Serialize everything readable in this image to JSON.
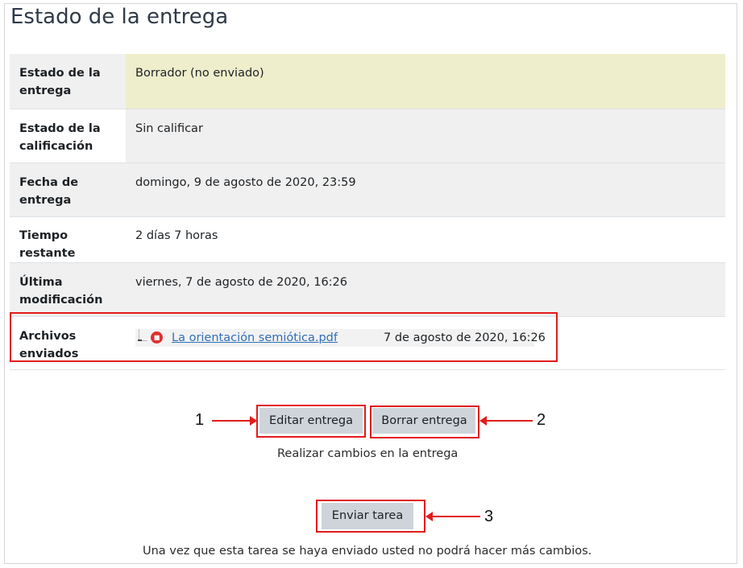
{
  "page": {
    "title": "Estado de la entrega"
  },
  "rows": [
    {
      "label": "Estado de la entrega",
      "value": "Borrador (no enviado)"
    },
    {
      "label": "Estado de la calificación",
      "value": "Sin calificar"
    },
    {
      "label": "Fecha de entrega",
      "value": "domingo, 9 de agosto de 2020, 23:59"
    },
    {
      "label": "Tiempo restante",
      "value": "2 días 7 horas"
    },
    {
      "label": "Última modificación",
      "value": "viernes, 7 de agosto de 2020, 16:26"
    },
    {
      "label": "Archivos enviados",
      "file_name": "La orientación semiótica.pdf",
      "file_date": "7 de agosto de 2020, 16:26",
      "file_icon": "pdf-icon"
    }
  ],
  "actions": {
    "edit_label": "Editar entrega",
    "delete_label": "Borrar entrega",
    "edit_help": "Realizar cambios en la entrega",
    "submit_label": "Enviar tarea",
    "submit_help": "Una vez que esta tarea se haya enviado usted no podrá hacer más cambios."
  },
  "annotations": {
    "one": "1",
    "two": "2",
    "three": "3",
    "highlight_color": "#e21b1b"
  },
  "colors": {
    "draft_background": "#eeeecc",
    "button_background": "#ced4da",
    "link": "#2f6fb7"
  }
}
